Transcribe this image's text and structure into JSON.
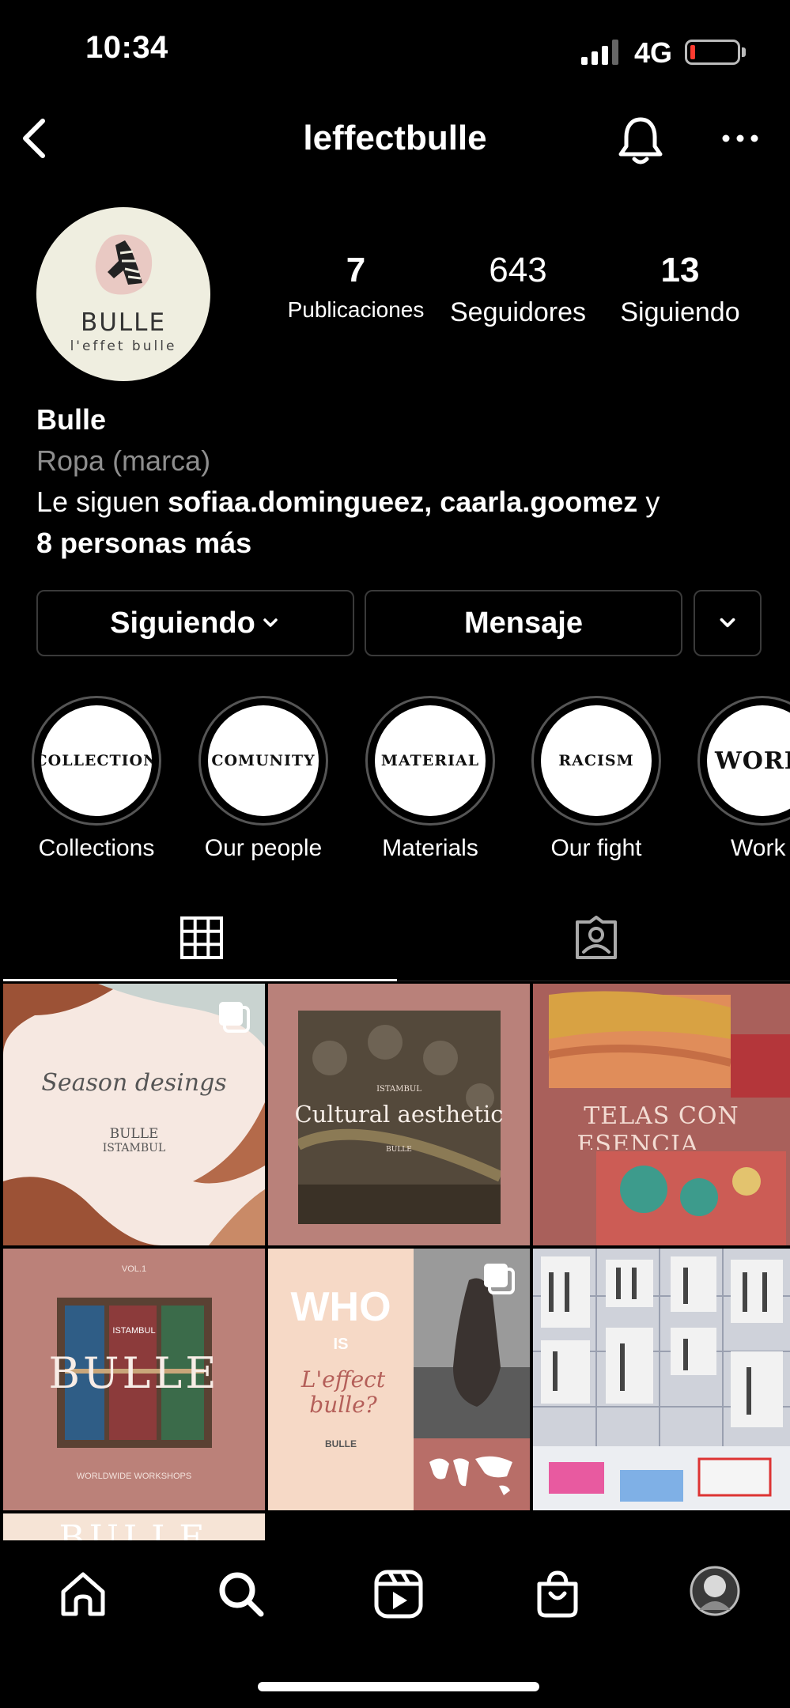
{
  "status_bar": {
    "time": "10:34",
    "network": "4G"
  },
  "header": {
    "username": "leffectbulle"
  },
  "profile": {
    "avatar_brand": "BULLE",
    "avatar_tagline": "l'effet bulle",
    "stats": {
      "posts": {
        "value": "7",
        "label": "Publicaciones"
      },
      "followers": {
        "value": "643",
        "label": "Seguidores"
      },
      "following": {
        "value": "13",
        "label": "Siguiendo"
      }
    },
    "name": "Bulle",
    "category": "Ropa (marca)",
    "followed_by_prefix": "Le siguen ",
    "followed_by_users": "sofiaa.domingueez, caarla.goomez",
    "followed_by_join": " y",
    "followed_by_more": "8 personas más"
  },
  "actions": {
    "following_label": "Siguiendo",
    "message_label": "Mensaje"
  },
  "highlights": [
    {
      "cover": "COLLECTION",
      "caption": "Collections"
    },
    {
      "cover": "COMUNITY",
      "caption": "Our people"
    },
    {
      "cover": "MATERIAL",
      "caption": "Materials"
    },
    {
      "cover": "RACISM",
      "caption": "Our fight"
    },
    {
      "cover": "WORK",
      "caption": "Work"
    }
  ],
  "posts": {
    "p1": {
      "script": "Season desings",
      "brand": "BULLE",
      "city": "ISTAMBUL"
    },
    "p2": {
      "city": "ISTAMBUL",
      "title": "Cultural aesthetic",
      "brand": "BULLE"
    },
    "p3": {
      "line1": "TELAS CON",
      "line2": "ESENCIA"
    },
    "p4": {
      "vol": "VOL.1",
      "city": "ISTAMBUL",
      "title": "BULLE",
      "footer": "WORLDWIDE WORKSHOPS"
    },
    "p5": {
      "who": "WHO",
      "is": "IS",
      "script": "L'effect bulle?",
      "brand": "BULLE"
    },
    "p7": {
      "partial": "BULLE"
    }
  },
  "colors": {
    "background": "#000000",
    "border": "#3a3a3a",
    "muted_text": "#8e8e8e",
    "battery_low": "#ff3b30"
  }
}
